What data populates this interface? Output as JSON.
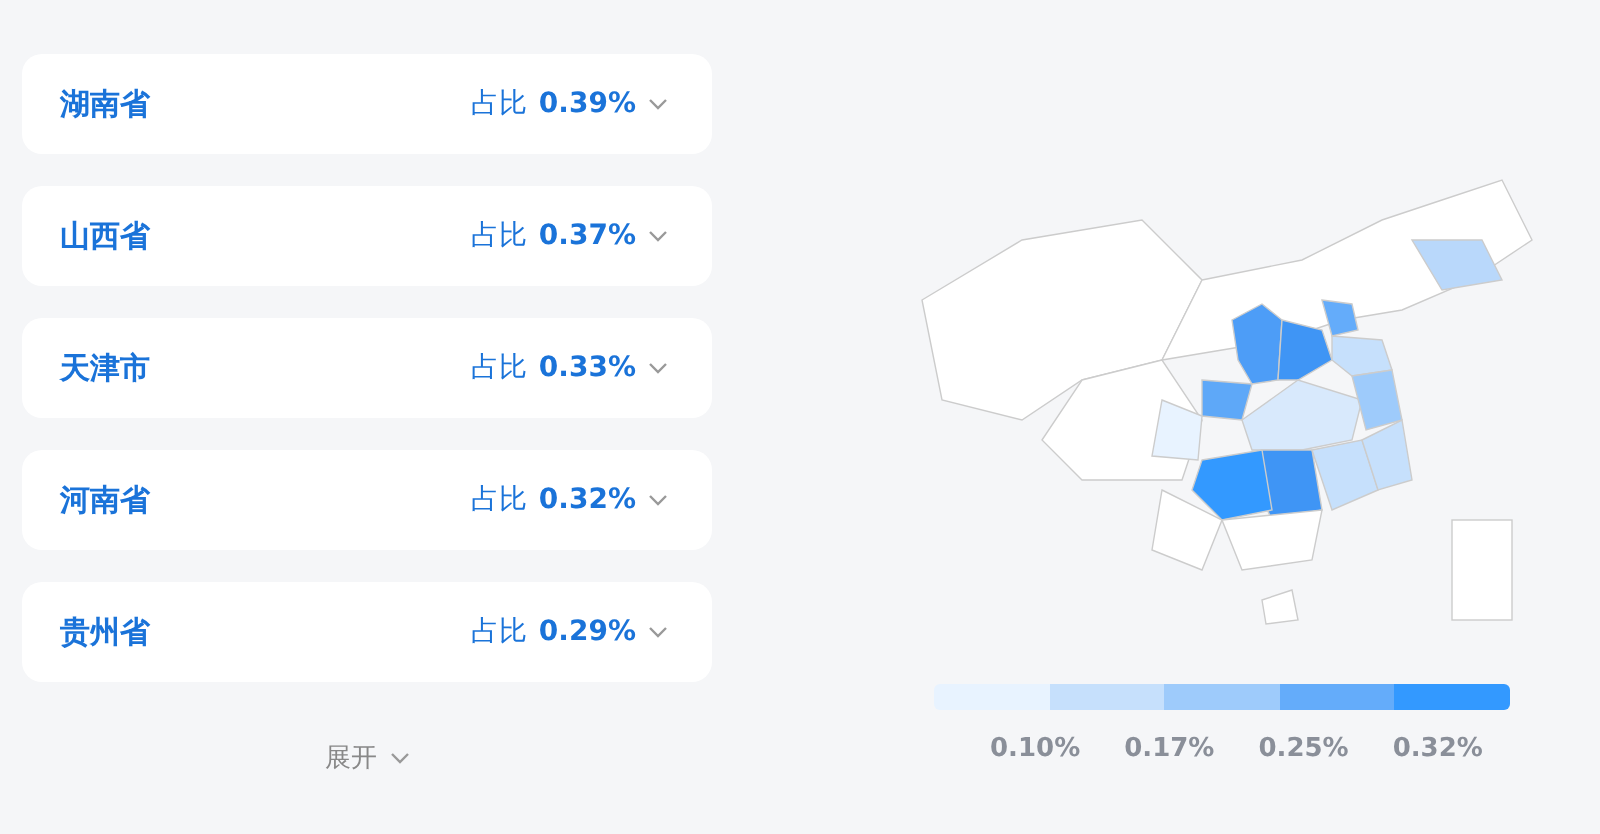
{
  "regions": [
    {
      "name": "湖南省",
      "share_label": "占比",
      "share": "0.39%"
    },
    {
      "name": "山西省",
      "share_label": "占比",
      "share": "0.37%"
    },
    {
      "name": "天津市",
      "share_label": "占比",
      "share": "0.33%"
    },
    {
      "name": "河南省",
      "share_label": "占比",
      "share": "0.32%"
    },
    {
      "name": "贵州省",
      "share_label": "占比",
      "share": "0.29%"
    }
  ],
  "expand_button": "展开",
  "legend": {
    "segments": [
      {
        "color": "#e8f3ff"
      },
      {
        "color": "#c6e0fc"
      },
      {
        "color": "#9ecbfb"
      },
      {
        "color": "#64acfa"
      },
      {
        "color": "#3399ff"
      }
    ],
    "labels": [
      "0.10%",
      "0.17%",
      "0.25%",
      "0.32%"
    ]
  }
}
